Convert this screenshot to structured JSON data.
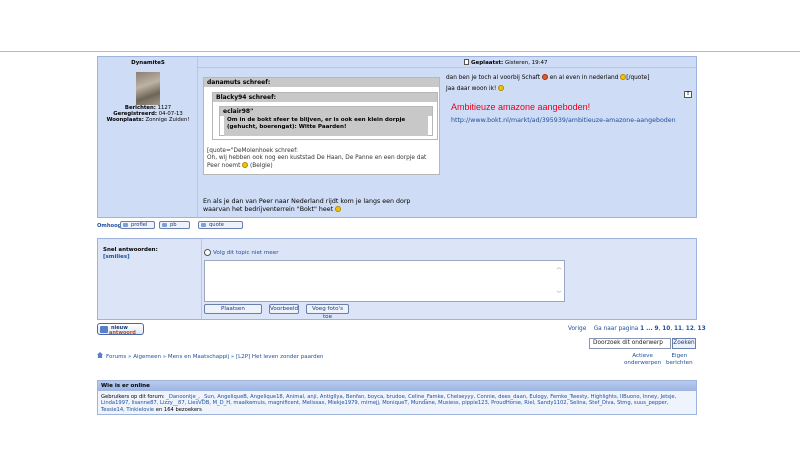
{
  "post": {
    "author": "DynamiteS",
    "posted_label": "Geplaatst:",
    "posted_value": "Gisteren, 19:47",
    "stats": {
      "berichten_label": "Berichten:",
      "berichten_value": "1127",
      "geregistreerd_label": "Geregistreerd:",
      "geregistreerd_value": "04-07-13",
      "woonplaats_label": "Woonplaats:",
      "woonplaats_value": "Zonnige Zuiden!"
    },
    "quote1_header": "danamuts schreef:",
    "quote2_header": "Blacky94 schreef:",
    "quote3_header": "eclair98\"",
    "quote3_text": "Om in de bokt sfeer te blijven, er is ook een klein dorpje (gehucht, boerengat): Witte Paarden!",
    "quote1_text_a": "[quote=\"DeMolenhoek schreef:",
    "quote1_text_b": "Oh, wij hebben ook nog een kuststad De Haan, De Panne en een dorpje dat",
    "quote1_text_c": "Peer noemt",
    "quote1_text_d": "(Belgie)",
    "body_a": "En als je dan van Peer naar Nederland rijdt kom je langs een dorp",
    "body_b": "waarvan het bedrijventerrein \"Bokt\" heet",
    "right_line1_a": "dan ben je toch al voorbij Schaft",
    "right_line1_b": "en al even in nederland",
    "right_line1_c": "[/quote]",
    "right_line2": "Jaa daar woon ik!",
    "ad_title": "Ambitieuze amazone aangeboden!",
    "ad_link": "http://www.bokt.nl/markt/ad/395939/ambitieuze-amazone-aangeboden",
    "report": "!"
  },
  "actions": {
    "omhoog": "Omhoog",
    "profiel": "profiel",
    "pb": "pb",
    "quote": "quote"
  },
  "reply": {
    "title": "Snel antwoorden:",
    "smilies": "[smilies]",
    "follow": "Volg dit topic niet meer",
    "btn_plaatsen": "Plaatsen",
    "btn_voorbeeld": "Voorbeeld",
    "btn_foto": "Voeg foto's toe"
  },
  "new_reply": {
    "line1": "nieuw",
    "line2": "antwoord"
  },
  "pager": {
    "vorige": "Vorige",
    "label": "Ga naar pagina",
    "p1": "1",
    "dots": "...",
    "p9": "9",
    "p10": "10",
    "p11": "11",
    "p12": "12",
    "p13": "13"
  },
  "search": {
    "value": "Doorzoek dit onderwerp",
    "button": "Zoeken"
  },
  "breadcrumb": {
    "forums": "Forums",
    "algemeen": "Algemeen",
    "mens": "Mens en Maatschappij",
    "topic": "[L2P] Het leven zonder paarden"
  },
  "links": {
    "actieve_1": "Actieve",
    "actieve_2": "onderwerpen",
    "eigen_1": "Eigen",
    "eigen_2": "berichten"
  },
  "online": {
    "title": "Wie is er online",
    "prefix": "Gebruikers op dit forum:",
    "users": "_Danoontje_, _Sun, AngeliqueB, Angelique18, Animal, anji, Antigllya, Benfan, boyca, brudoe, Celine_Famke, Chelseyyy, Connie, dees_daan, Eulogy, Femke_Twesty, Highlights, IIBuono, Inney, Jetsje, Linda1997, lisanne87, Lizzy__87, LiesVDB, M_D_H, maaikemuis, magnificent, Melissax, Miekje1979, mirnejj, MoniqueT, Mundane, Musiess, pippie123, ProudHorse, Riel, Sandy1102, Selina, Stef_Diva, Stmg, suus_pepper, Tessie14, Tinkielovie",
    "suffix": "en 164 bezoekers"
  },
  "colors": {
    "post_bg": "#cfdcf5",
    "border": "#9fb4dc",
    "link": "#1f4f9a",
    "ad_red": "#e8001c"
  }
}
